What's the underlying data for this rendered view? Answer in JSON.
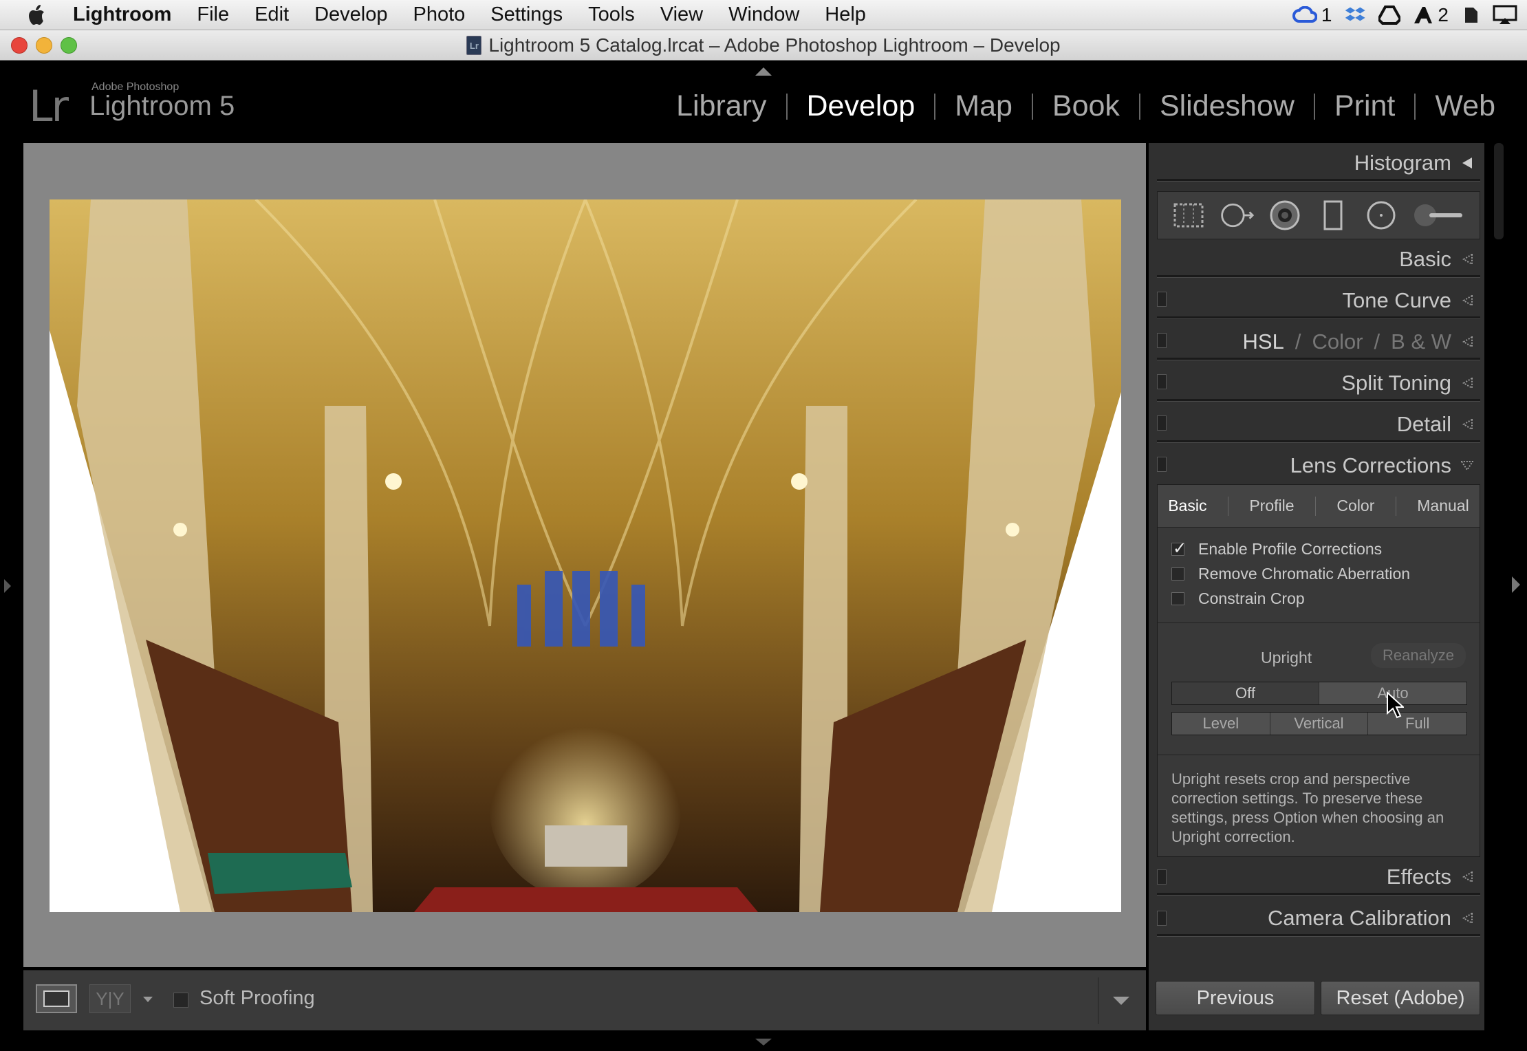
{
  "menubar": {
    "app": "Lightroom",
    "items": [
      "File",
      "Edit",
      "Develop",
      "Photo",
      "Settings",
      "Tools",
      "View",
      "Window",
      "Help"
    ],
    "tray": {
      "cc_count": "1",
      "adobe_count": "2"
    }
  },
  "window": {
    "title": "Lightroom 5 Catalog.lrcat – Adobe Photoshop Lightroom – Develop",
    "doc_icon": "Lr"
  },
  "header": {
    "logo": "Lr",
    "brand_small": "Adobe Photoshop",
    "brand": "Lightroom 5",
    "modules": [
      {
        "label": "Library"
      },
      {
        "label": "Develop"
      },
      {
        "label": "Map"
      },
      {
        "label": "Book"
      },
      {
        "label": "Slideshow"
      },
      {
        "label": "Print"
      },
      {
        "label": "Web"
      }
    ],
    "active_module": "Develop"
  },
  "panel": {
    "histogram": "Histogram",
    "sections": {
      "basic": "Basic",
      "tone_curve": "Tone Curve",
      "hsl": "HSL",
      "color": "Color",
      "bw": "B & W",
      "slash": "/",
      "split_toning": "Split Toning",
      "detail": "Detail",
      "lens": "Lens Corrections",
      "effects": "Effects",
      "calibration": "Camera Calibration"
    },
    "lens_tabs": [
      "Basic",
      "Profile",
      "Color",
      "Manual"
    ],
    "lens_active_tab": "Basic",
    "checkboxes": [
      {
        "label": "Enable Profile Corrections",
        "checked": true
      },
      {
        "label": "Remove Chromatic Aberration",
        "checked": false
      },
      {
        "label": "Constrain Crop",
        "checked": false
      }
    ],
    "upright_label": "Upright",
    "reanalyze": "Reanalyze",
    "upright_row1": [
      "Off",
      "Auto"
    ],
    "upright_row2": [
      "Level",
      "Vertical",
      "Full"
    ],
    "selected_upright": "Off",
    "note": "Upright resets crop and perspective correction settings. To preserve these settings, press Option when choosing an Upright correction."
  },
  "toolbar": {
    "soft_proofing": "Soft Proofing",
    "soft_proofing_checked": false,
    "view_yy": "Y|Y"
  },
  "buttons": {
    "previous": "Previous",
    "reset": "Reset (Adobe)"
  },
  "colors": {
    "accent_active": "#ffffff",
    "panel_bg": "#303030",
    "canvas_bg": "#868686"
  }
}
